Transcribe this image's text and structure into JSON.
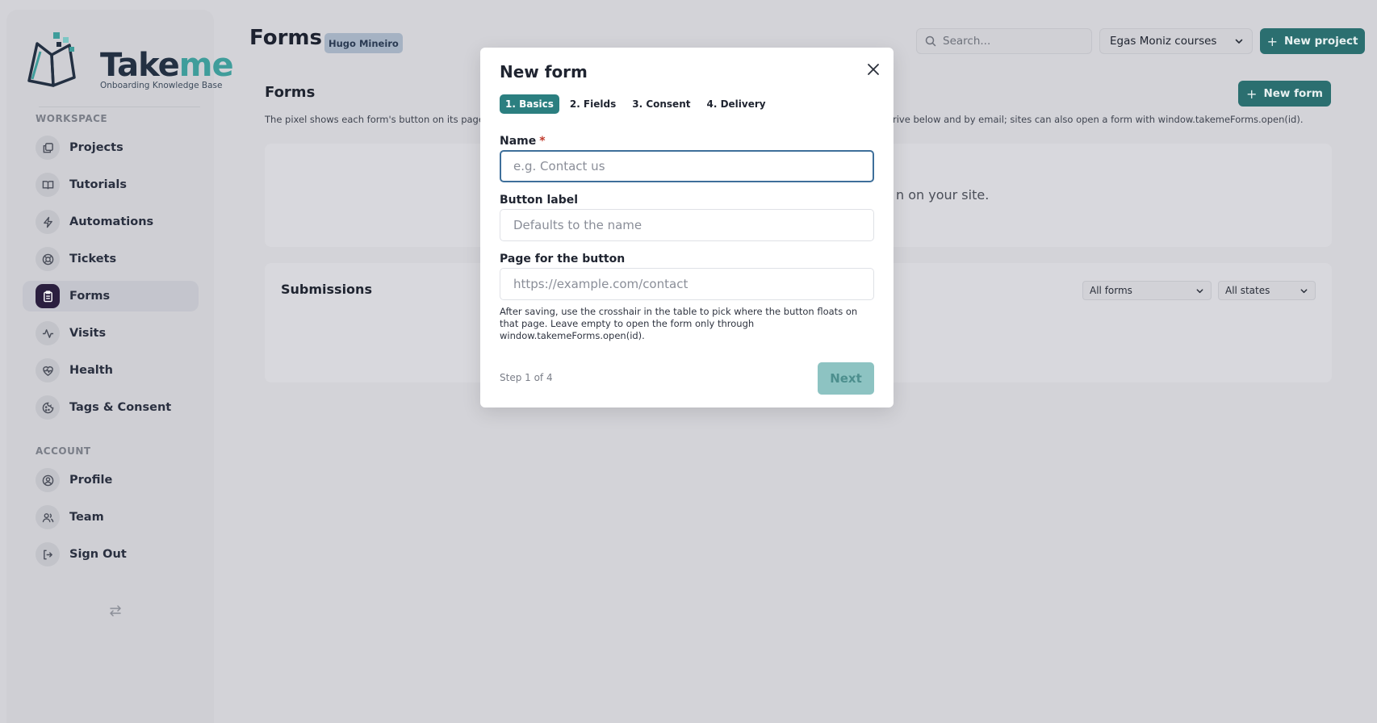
{
  "brand": {
    "name_part1": "Take",
    "name_part2": "me",
    "tagline": "Onboarding Knowledge Base",
    "accent": "#3f9d9b"
  },
  "sidebar": {
    "workspace_label": "WORKSPACE",
    "account_label": "ACCOUNT",
    "workspace_items": [
      {
        "label": "Projects",
        "icon": "projects-icon"
      },
      {
        "label": "Tutorials",
        "icon": "book-icon"
      },
      {
        "label": "Automations",
        "icon": "bolt-icon"
      },
      {
        "label": "Tickets",
        "icon": "lifebuoy-icon"
      },
      {
        "label": "Forms",
        "icon": "clipboard-icon",
        "active": true
      },
      {
        "label": "Visits",
        "icon": "activity-icon"
      },
      {
        "label": "Health",
        "icon": "heart-pulse-icon"
      },
      {
        "label": "Tags & Consent",
        "icon": "cookie-icon"
      }
    ],
    "account_items": [
      {
        "label": "Profile",
        "icon": "user-circle-icon"
      },
      {
        "label": "Team",
        "icon": "users-icon"
      },
      {
        "label": "Sign Out",
        "icon": "sign-out-icon"
      }
    ]
  },
  "header": {
    "title": "Forms",
    "user_badge": "Hugo Mineiro",
    "search_placeholder": "Search...",
    "project_selected": "Egas Moniz courses",
    "new_project_label": "New project"
  },
  "main": {
    "forms_title": "Forms",
    "new_form_label": "New form",
    "description_left": "The pixel shows each form's button on its page",
    "description_right": "rive below and by email; sites can also open a form with window.takemeForms.open(id).",
    "empty_text": "n on your site.",
    "submissions_title": "Submissions",
    "filter_forms": "All forms",
    "filter_states": "All states"
  },
  "modal": {
    "title": "New form",
    "steps": [
      "1. Basics",
      "2. Fields",
      "3. Consent",
      "4. Delivery"
    ],
    "active_step": 0,
    "name_label": "Name",
    "name_required": "*",
    "name_placeholder": "e.g. Contact us",
    "button_label_label": "Button label",
    "button_label_placeholder": "Defaults to the name",
    "page_label": "Page for the button",
    "page_placeholder": "https://example.com/contact",
    "help_text": "After saving, use the crosshair in the table to pick where the button floats on that page. Leave empty to open the form only through window.takemeForms.open(id).",
    "step_count": "Step 1 of 4",
    "next_label": "Next"
  },
  "colors": {
    "teal_button": "#2b6f70",
    "active_step": "#2b7f80",
    "active_nav": "#2b1f3f",
    "required": "#c0392b"
  }
}
